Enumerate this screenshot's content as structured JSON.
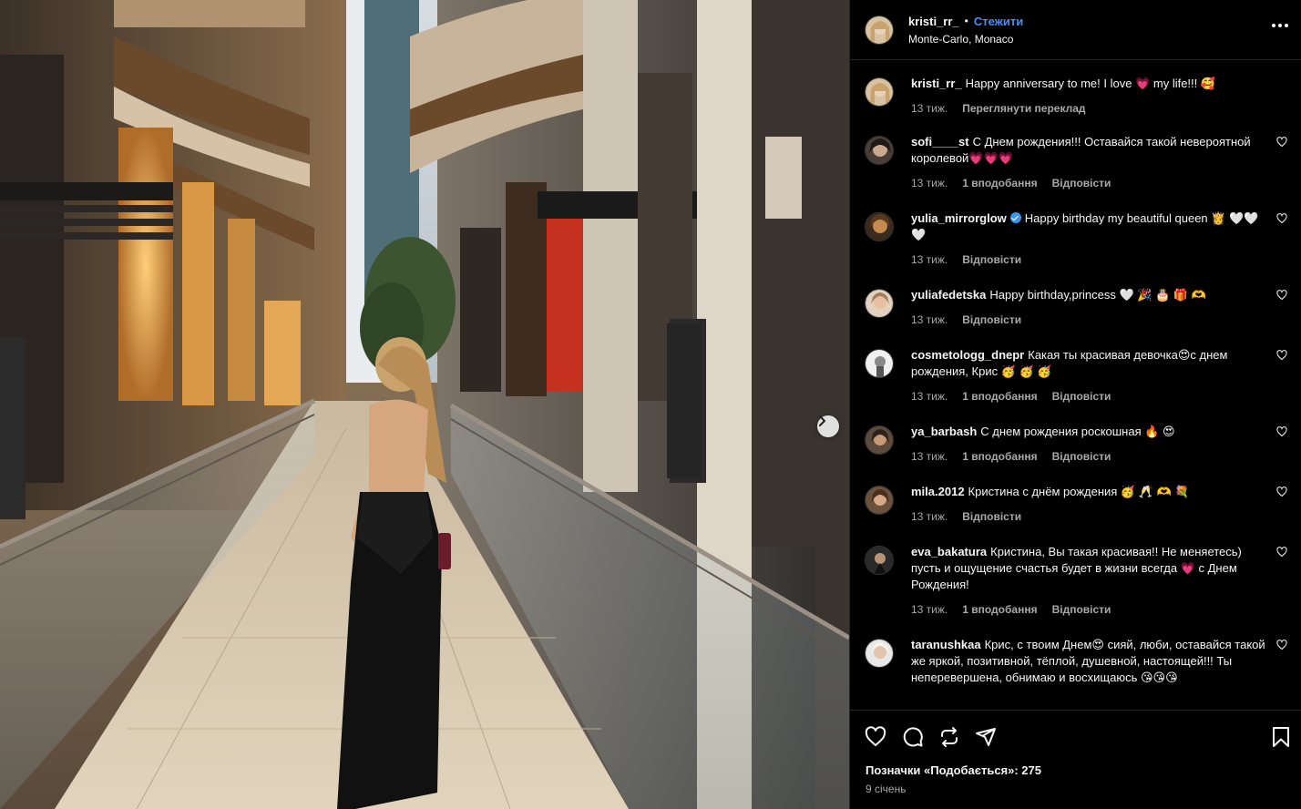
{
  "post": {
    "author": "kristi_rr_",
    "dot": "•",
    "follow_label": "Стежити",
    "location": "Monte-Carlo, Monaco",
    "more_icon": "more-horizontal-icon"
  },
  "comments": [
    {
      "user": "kristi_rr_",
      "text": "Happy anniversary to me! I love 💗 my life!!! 🥰",
      "time": "13 тиж.",
      "likes": "",
      "reply": "",
      "translate": "Переглянути переклад",
      "verified": false,
      "heart": false
    },
    {
      "user": "sofi____st",
      "text": "С Днем рождения!!! Оставайся такой невероятной королевой💗💗💗",
      "time": "13 тиж.",
      "likes": "1 вподобання",
      "reply": "Відповісти",
      "verified": false,
      "heart": true
    },
    {
      "user": "yulia_mirrorglow",
      "text": "Happy birthday my beautiful queen 👸 🤍🤍🤍",
      "time": "13 тиж.",
      "likes": "",
      "reply": "Відповісти",
      "verified": true,
      "heart": true
    },
    {
      "user": "yuliafedetska",
      "text": "Happy birthday,princess 🤍 🎉 🎂 🎁 🫶",
      "time": "13 тиж.",
      "likes": "",
      "reply": "Відповісти",
      "verified": false,
      "heart": true
    },
    {
      "user": "cosmetologg_dnepr",
      "text": "Какая ты красивая девочка😍с днем рождения, Крис 🥳 🥳 🥳",
      "time": "13 тиж.",
      "likes": "1 вподобання",
      "reply": "Відповісти",
      "verified": false,
      "heart": true
    },
    {
      "user": "ya_barbash",
      "text": "С днем рождения роскошная 🔥 😍",
      "time": "13 тиж.",
      "likes": "1 вподобання",
      "reply": "Відповісти",
      "verified": false,
      "heart": true
    },
    {
      "user": "mila.2012",
      "text": "Кристина с днём рождения 🥳 🥂 🫶 💐",
      "time": "13 тиж.",
      "likes": "",
      "reply": "Відповісти",
      "verified": false,
      "heart": true
    },
    {
      "user": "eva_bakatura",
      "text": "Кристина, Вы такая красивая!! Не меняетесь) пусть и ощущение счастья будет в жизни всегда 💗 с Днем Рождения!",
      "time": "13 тиж.",
      "likes": "1 вподобання",
      "reply": "Відповісти",
      "verified": false,
      "heart": true
    },
    {
      "user": "taranushkaa",
      "text": "Крис, с твоим Днем😍 сияй, люби, оставайся такой же яркой, позитивной, тёплой, душевной, настоящей!!! Ты неперевершена, обнимаю и восхищаюсь 😘😘😘",
      "time": "",
      "likes": "",
      "reply": "",
      "verified": false,
      "heart": true
    }
  ],
  "actions": {
    "like_icon": "heart-icon",
    "comment_icon": "comment-icon",
    "repost_icon": "repost-icon",
    "share_icon": "share-icon",
    "save_icon": "bookmark-icon"
  },
  "likes_text": "Позначки «Подобається»: 275",
  "date_text": "9 січень",
  "colors": {
    "panel_bg": "#000000",
    "text": "#f5f5f5",
    "muted": "#a8a8a8",
    "follow": "#4a8df8",
    "divider": "#262626"
  }
}
